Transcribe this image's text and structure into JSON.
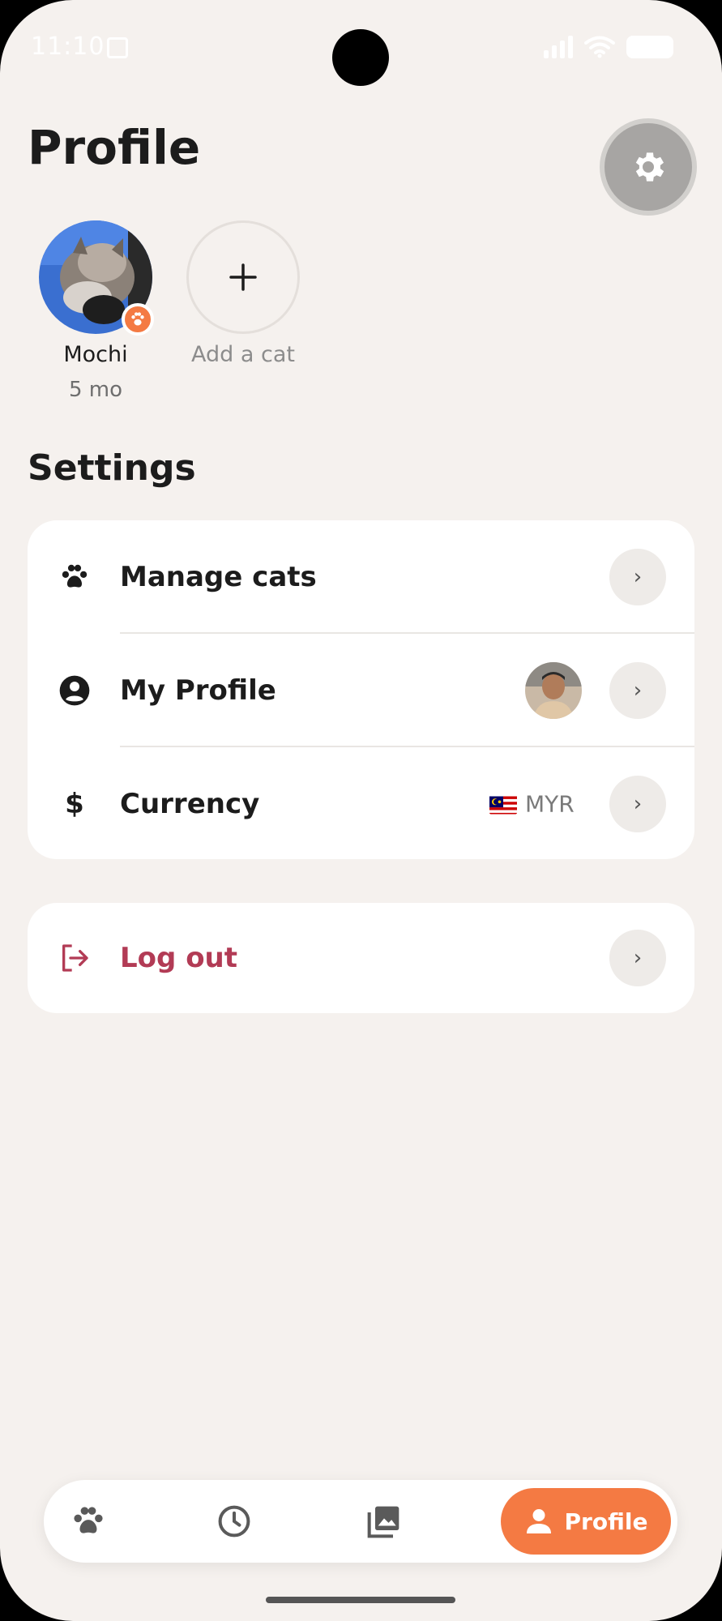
{
  "status_bar": {
    "time": "11:10"
  },
  "header": {
    "title": "Profile"
  },
  "cats": [
    {
      "name": "Mochi",
      "age": "5 mo"
    }
  ],
  "add_cat": {
    "label": "Add a cat"
  },
  "settings": {
    "title": "Settings",
    "items": [
      {
        "label": "Manage cats",
        "icon": "paw-icon"
      },
      {
        "label": "My Profile",
        "icon": "user-circle-icon"
      },
      {
        "label": "Currency",
        "icon": "dollar-icon",
        "value": "MYR"
      }
    ]
  },
  "logout": {
    "label": "Log out",
    "color": "#b23b55"
  },
  "nav": {
    "items": [
      "paw-icon",
      "clock-icon",
      "gallery-icon"
    ],
    "active_label": "Profile",
    "accent": "#f47a43"
  }
}
